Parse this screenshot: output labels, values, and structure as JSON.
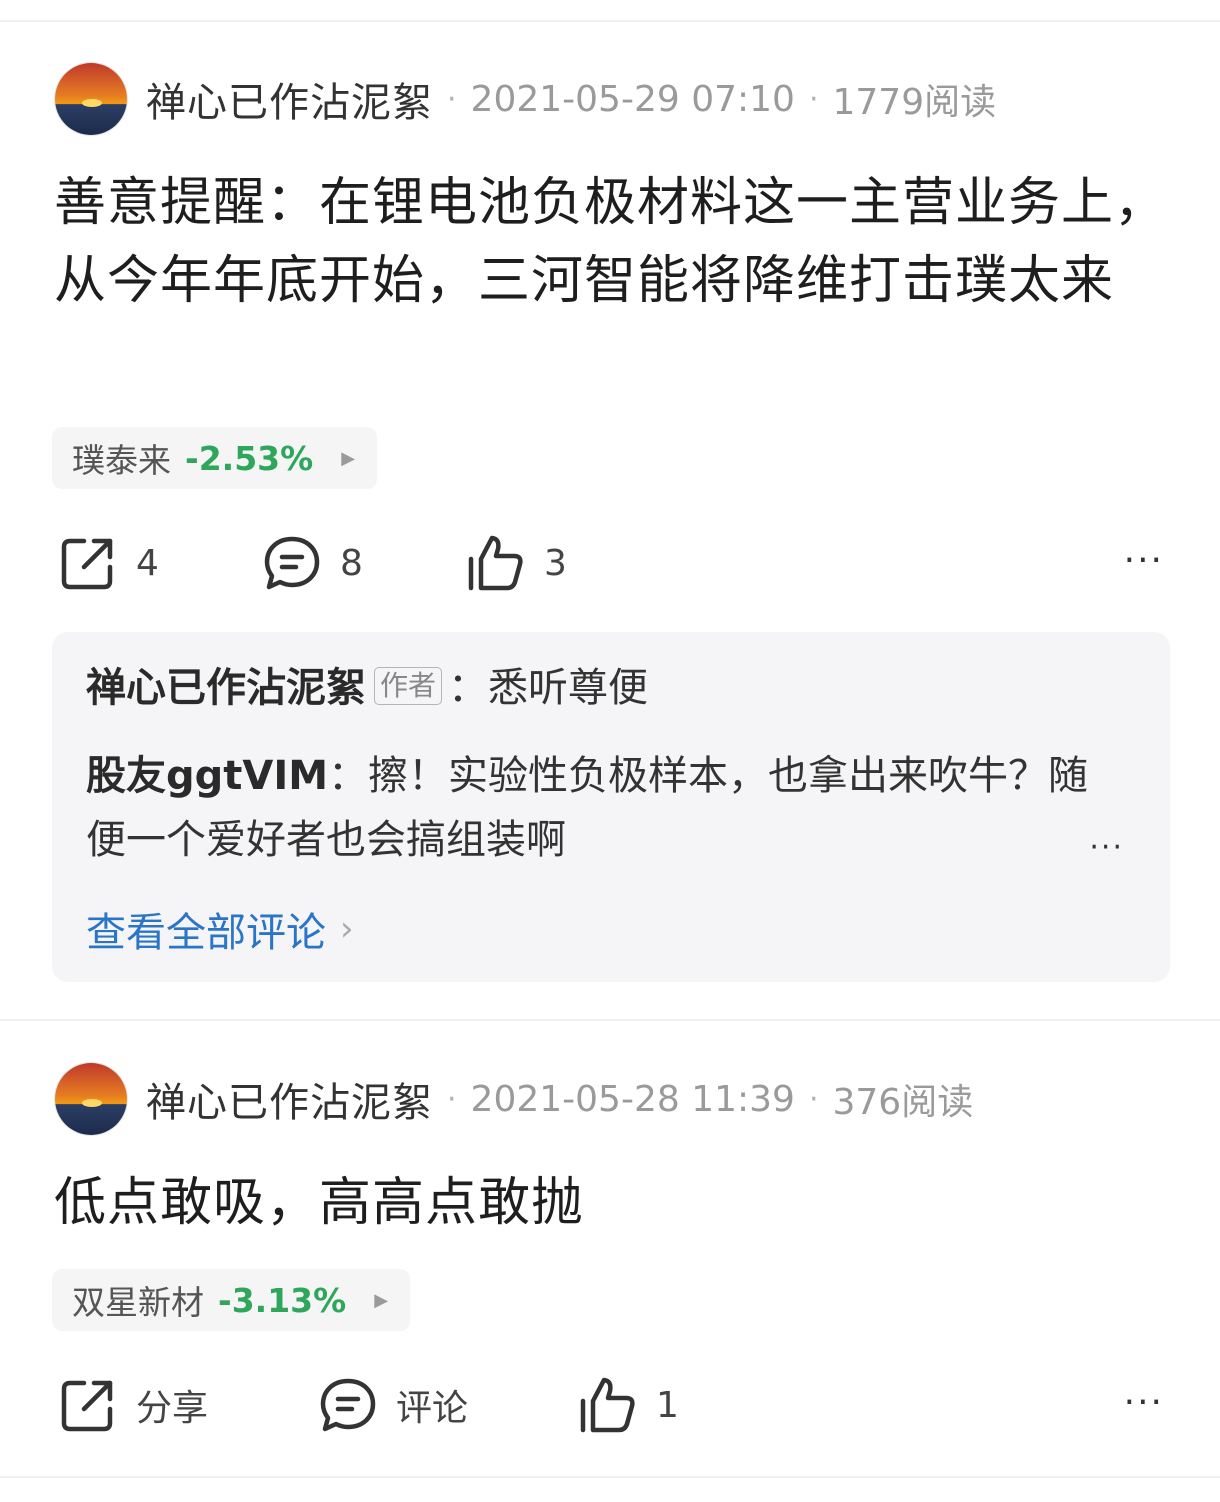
{
  "posts": [
    {
      "author": "禅心已作沾泥絮",
      "date": "2021-05-29 07:10",
      "reads": "1779阅读",
      "separator": "·",
      "content": "善意提醒：在锂电池负极材料这一主营业务上，从今年年底开始，三河智能将降维打击璞太来",
      "stock": {
        "name": "璞泰来",
        "change": "-2.53%",
        "color": "#2ea65b"
      },
      "actions": {
        "share": "4",
        "comment": "8",
        "like": "3",
        "more": "···"
      },
      "comments": [
        {
          "user": "禅心已作沾泥絮",
          "badge": "作者",
          "sep": "：",
          "text": "悉听尊便"
        },
        {
          "user": "股友ggtVIM",
          "sep": "：",
          "text": "擦！实验性负极样本，也拿出来吹牛？随便一个爱好者也会搞组装啊"
        }
      ],
      "comment_more": "···",
      "view_all": "查看全部评论",
      "view_all_chevron": "›"
    },
    {
      "author": "禅心已作沾泥絮",
      "date": "2021-05-28 11:39",
      "reads": "376阅读",
      "separator": "·",
      "content": "低点敢吸，高高点敢抛",
      "stock": {
        "name": "双星新材",
        "change": "-3.13%",
        "color": "#2ea65b"
      },
      "actions": {
        "share": "分享",
        "comment": "评论",
        "like": "1",
        "more": "···"
      }
    }
  ],
  "icons": {
    "share": "share-icon",
    "comment": "comment-icon",
    "like": "thumbs-up-icon",
    "more": "more-icon",
    "stock_arrow": "triangle-right-icon"
  }
}
